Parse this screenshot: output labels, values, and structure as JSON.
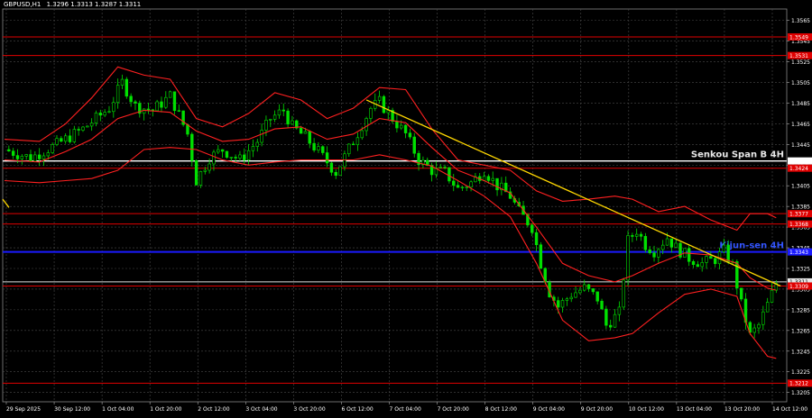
{
  "header": {
    "symbol": "GBPUSD,H1",
    "ohlc": "1.3296 1.3313 1.3287 1.3311"
  },
  "colors": {
    "background": "#000000",
    "grid": "#4a4a4a",
    "candle_bull": "#00e000",
    "candle_bear": "#00e000",
    "bollinger": "#ff2020",
    "level_red": "#e00000",
    "level_white": "#ffffff",
    "level_blue": "#1a1aff",
    "trendline": "#ffd700",
    "axis_text": "#ffffff"
  },
  "chart_data": {
    "type": "candlestick",
    "title": "GBPUSD,H1",
    "ylim": [
      1.3196,
      1.3576
    ],
    "y_ticks": [
      "1.3565",
      "1.3545",
      "1.3525",
      "1.3505",
      "1.3485",
      "1.3465",
      "1.3445",
      "1.3425",
      "1.3405",
      "1.3385",
      "1.3365",
      "1.3345",
      "1.3325",
      "1.3305",
      "1.3285",
      "1.3265",
      "1.3245",
      "1.3225",
      "1.3205"
    ],
    "x_ticks": [
      "29 Sep 2025",
      "30 Sep 12:00",
      "1 Oct 04:00",
      "1 Oct 20:00",
      "2 Oct 12:00",
      "3 Oct 04:00",
      "3 Oct 20:00",
      "6 Oct 12:00",
      "7 Oct 04:00",
      "7 Oct 20:00",
      "8 Oct 12:00",
      "9 Oct 04:00",
      "9 Oct 20:00",
      "10 Oct 12:00",
      "13 Oct 04:00",
      "13 Oct 20:00",
      "14 Oct 12:00"
    ],
    "close_path": [
      [
        0,
        1.344
      ],
      [
        6,
        1.3432
      ],
      [
        12,
        1.3445
      ],
      [
        18,
        1.346
      ],
      [
        24,
        1.348
      ],
      [
        27,
        1.3505
      ],
      [
        30,
        1.3482
      ],
      [
        34,
        1.3478
      ],
      [
        38,
        1.3492
      ],
      [
        42,
        1.3455
      ],
      [
        44,
        1.341
      ],
      [
        47,
        1.3432
      ],
      [
        50,
        1.344
      ],
      [
        54,
        1.343
      ],
      [
        58,
        1.3448
      ],
      [
        61,
        1.347
      ],
      [
        64,
        1.3478
      ],
      [
        66,
        1.3462
      ],
      [
        69,
        1.3452
      ],
      [
        72,
        1.3438
      ],
      [
        76,
        1.3418
      ],
      [
        80,
        1.3448
      ],
      [
        84,
        1.348
      ],
      [
        86,
        1.3486
      ],
      [
        89,
        1.347
      ],
      [
        92,
        1.3455
      ],
      [
        95,
        1.343
      ],
      [
        98,
        1.342
      ],
      [
        101,
        1.3418
      ],
      [
        104,
        1.3402
      ],
      [
        107,
        1.3408
      ],
      [
        110,
        1.342
      ],
      [
        113,
        1.3405
      ],
      [
        116,
        1.3395
      ],
      [
        118,
        1.338
      ],
      [
        121,
        1.3365
      ],
      [
        123,
        1.333
      ],
      [
        125,
        1.3302
      ],
      [
        127,
        1.3288
      ],
      [
        130,
        1.33
      ],
      [
        133,
        1.3306
      ],
      [
        136,
        1.3296
      ],
      [
        138,
        1.327
      ],
      [
        141,
        1.3282
      ],
      [
        143,
        1.3352
      ],
      [
        145,
        1.3362
      ],
      [
        147,
        1.3348
      ],
      [
        149,
        1.3342
      ],
      [
        152,
        1.3355
      ],
      [
        154,
        1.3345
      ],
      [
        157,
        1.3335
      ],
      [
        160,
        1.333
      ],
      [
        163,
        1.3334
      ],
      [
        165,
        1.3342
      ],
      [
        167,
        1.3328
      ],
      [
        169,
        1.329
      ],
      [
        171,
        1.326
      ],
      [
        173,
        1.327
      ],
      [
        175,
        1.329
      ],
      [
        177,
        1.3311
      ]
    ],
    "bollinger_upper": [
      [
        0,
        1.345
      ],
      [
        8,
        1.3448
      ],
      [
        14,
        1.3465
      ],
      [
        20,
        1.349
      ],
      [
        26,
        1.352
      ],
      [
        32,
        1.3512
      ],
      [
        38,
        1.3508
      ],
      [
        44,
        1.347
      ],
      [
        50,
        1.3462
      ],
      [
        56,
        1.3475
      ],
      [
        62,
        1.3495
      ],
      [
        68,
        1.3488
      ],
      [
        74,
        1.347
      ],
      [
        80,
        1.348
      ],
      [
        86,
        1.35
      ],
      [
        92,
        1.3498
      ],
      [
        98,
        1.346
      ],
      [
        104,
        1.343
      ],
      [
        110,
        1.3425
      ],
      [
        116,
        1.342
      ],
      [
        122,
        1.34
      ],
      [
        128,
        1.339
      ],
      [
        134,
        1.3392
      ],
      [
        140,
        1.3395
      ],
      [
        144,
        1.3392
      ],
      [
        150,
        1.338
      ],
      [
        156,
        1.3385
      ],
      [
        162,
        1.3372
      ],
      [
        168,
        1.3362
      ],
      [
        171,
        1.3378
      ],
      [
        175,
        1.3378
      ],
      [
        177,
        1.3374
      ]
    ],
    "bollinger_middle": [
      [
        0,
        1.343
      ],
      [
        8,
        1.3428
      ],
      [
        14,
        1.3438
      ],
      [
        20,
        1.345
      ],
      [
        26,
        1.347
      ],
      [
        32,
        1.3478
      ],
      [
        38,
        1.3476
      ],
      [
        44,
        1.3458
      ],
      [
        50,
        1.3448
      ],
      [
        56,
        1.345
      ],
      [
        62,
        1.346
      ],
      [
        68,
        1.3462
      ],
      [
        74,
        1.345
      ],
      [
        80,
        1.3455
      ],
      [
        86,
        1.347
      ],
      [
        92,
        1.3466
      ],
      [
        98,
        1.3442
      ],
      [
        104,
        1.342
      ],
      [
        110,
        1.341
      ],
      [
        116,
        1.3398
      ],
      [
        122,
        1.3365
      ],
      [
        128,
        1.333
      ],
      [
        134,
        1.3318
      ],
      [
        140,
        1.3312
      ],
      [
        144,
        1.3318
      ],
      [
        150,
        1.333
      ],
      [
        156,
        1.334
      ],
      [
        162,
        1.3338
      ],
      [
        168,
        1.333
      ],
      [
        171,
        1.3316
      ],
      [
        175,
        1.3306
      ],
      [
        177,
        1.3304
      ]
    ],
    "bollinger_lower": [
      [
        0,
        1.341
      ],
      [
        8,
        1.3408
      ],
      [
        14,
        1.341
      ],
      [
        20,
        1.3412
      ],
      [
        26,
        1.342
      ],
      [
        32,
        1.344
      ],
      [
        38,
        1.3442
      ],
      [
        44,
        1.344
      ],
      [
        50,
        1.343
      ],
      [
        56,
        1.3425
      ],
      [
        62,
        1.3428
      ],
      [
        68,
        1.343
      ],
      [
        74,
        1.343
      ],
      [
        80,
        1.343
      ],
      [
        86,
        1.3435
      ],
      [
        92,
        1.343
      ],
      [
        98,
        1.3424
      ],
      [
        104,
        1.341
      ],
      [
        110,
        1.3395
      ],
      [
        116,
        1.3375
      ],
      [
        122,
        1.333
      ],
      [
        128,
        1.3275
      ],
      [
        134,
        1.3255
      ],
      [
        140,
        1.3258
      ],
      [
        144,
        1.3262
      ],
      [
        150,
        1.3282
      ],
      [
        156,
        1.33
      ],
      [
        162,
        1.3305
      ],
      [
        168,
        1.3298
      ],
      [
        171,
        1.3262
      ],
      [
        175,
        1.324
      ],
      [
        177,
        1.3238
      ]
    ],
    "trendline": {
      "from": [
        83,
        1.3488
      ],
      "to": [
        178,
        1.3308
      ]
    },
    "levels": [
      {
        "price": 1.3549,
        "label": "1.3549",
        "color": "#e00000",
        "kind": "red"
      },
      {
        "price": 1.3531,
        "label": "1.3531",
        "color": "#e00000",
        "kind": "red"
      },
      {
        "price": 1.3429,
        "label": "1.3426",
        "color": "#ffffff",
        "kind": "white",
        "text": "Senkou Span B 4H"
      },
      {
        "price": 1.3422,
        "label": "1.3424",
        "color": "#e00000",
        "kind": "red"
      },
      {
        "price": 1.3378,
        "label": "1.3377",
        "color": "#e00000",
        "kind": "red"
      },
      {
        "price": 1.3368,
        "label": "1.3368",
        "color": "#e00000",
        "kind": "red"
      },
      {
        "price": 1.3341,
        "label": "1.3343",
        "color": "#1a1aff",
        "kind": "blue",
        "text": "Kijun-sen 4H"
      },
      {
        "price": 1.3312,
        "label": "1.3311",
        "color": "#e0e0e0",
        "kind": "price"
      },
      {
        "price": 1.3308,
        "label": "1.3309",
        "color": "#e00000",
        "kind": "red"
      },
      {
        "price": 1.3214,
        "label": "1.3212",
        "color": "#e00000",
        "kind": "red"
      }
    ]
  }
}
